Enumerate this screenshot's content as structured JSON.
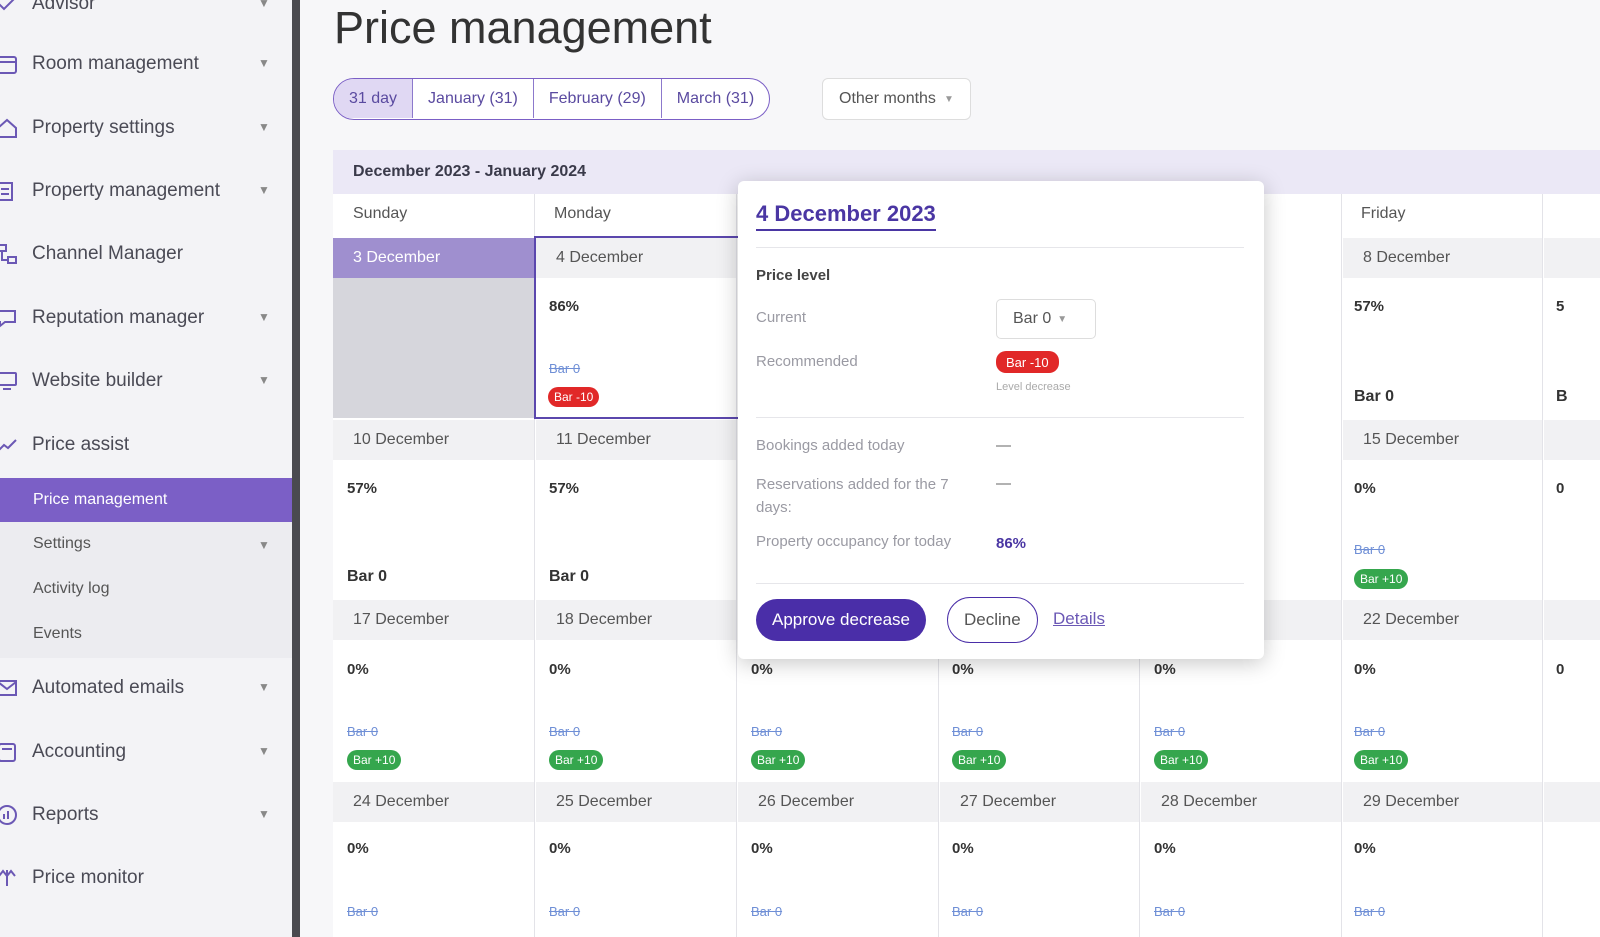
{
  "sidebar": {
    "items": [
      {
        "label": "Advisor",
        "icon": "advisor-icon",
        "caret": true
      },
      {
        "label": "Room management",
        "icon": "calendar-icon",
        "caret": true
      },
      {
        "label": "Property settings",
        "icon": "home-icon",
        "caret": true
      },
      {
        "label": "Property management",
        "icon": "checklist-icon",
        "caret": true
      },
      {
        "label": "Channel Manager",
        "icon": "network-icon",
        "caret": false
      },
      {
        "label": "Reputation manager",
        "icon": "chat-icon",
        "caret": true
      },
      {
        "label": "Website builder",
        "icon": "monitor-icon",
        "caret": true
      },
      {
        "label": "Price assist",
        "icon": "trend-icon",
        "caret": false
      },
      {
        "label": "Automated emails",
        "icon": "mail-icon",
        "caret": true
      },
      {
        "label": "Accounting",
        "icon": "calculator-icon",
        "caret": true
      },
      {
        "label": "Reports",
        "icon": "chart-icon",
        "caret": true
      },
      {
        "label": "Price monitor",
        "icon": "scales-icon",
        "caret": false
      }
    ],
    "subitems": [
      {
        "label": "Price management",
        "active": true
      },
      {
        "label": "Settings",
        "caret": true
      },
      {
        "label": "Activity log"
      },
      {
        "label": "Events"
      }
    ]
  },
  "main": {
    "title": "Price management",
    "tabs": [
      "31 day",
      "January (31)",
      "February (29)",
      "March (31)"
    ],
    "other_months": "Other months",
    "calendar": {
      "range": "December 2023 - January 2024",
      "weekdays": [
        "Sunday",
        "Monday",
        "Friday"
      ],
      "weeks": [
        [
          "3 December",
          "4 December",
          "8 December"
        ],
        [
          "10 December",
          "11 December",
          "15 December"
        ],
        [
          "17 December",
          "18 December",
          "22 December"
        ],
        [
          "24 December",
          "25 December",
          "26 December",
          "27 December",
          "28 December",
          "29 December"
        ]
      ],
      "occupancy": {
        "w1": [
          "86%",
          "57%",
          "5"
        ],
        "w2": [
          "57%",
          "57%",
          "0%",
          "0"
        ],
        "w3": [
          "0%",
          "0%",
          "0%",
          "0%",
          "0%",
          "0%",
          "0"
        ],
        "w4": [
          "0%",
          "0%",
          "0%",
          "0%",
          "0%",
          "0%"
        ]
      },
      "bar_current": "Bar 0",
      "badge_plus": "Bar +10",
      "badge_minus": "Bar -10",
      "partial_bar": "B"
    },
    "popover": {
      "date": "4 December 2023",
      "section": "Price level",
      "current_label": "Current",
      "current_value": "Bar 0",
      "recommended_label": "Recommended",
      "recommended_value": "Bar -10",
      "level_note": "Level decrease",
      "bookings_label": "Bookings added today",
      "bookings_value": "—",
      "reservations_label": "Reservations added for the 7 days:",
      "reservations_value": "—",
      "occupancy_label": "Property occupancy for today",
      "occupancy_value": "86%",
      "approve": "Approve decrease",
      "decline": "Decline",
      "details": "Details"
    }
  },
  "colors": {
    "accent": "#4a2ea8",
    "sidebar_active": "#7b5fc6",
    "badge_green": "#35a64d",
    "badge_red": "#e12828"
  }
}
